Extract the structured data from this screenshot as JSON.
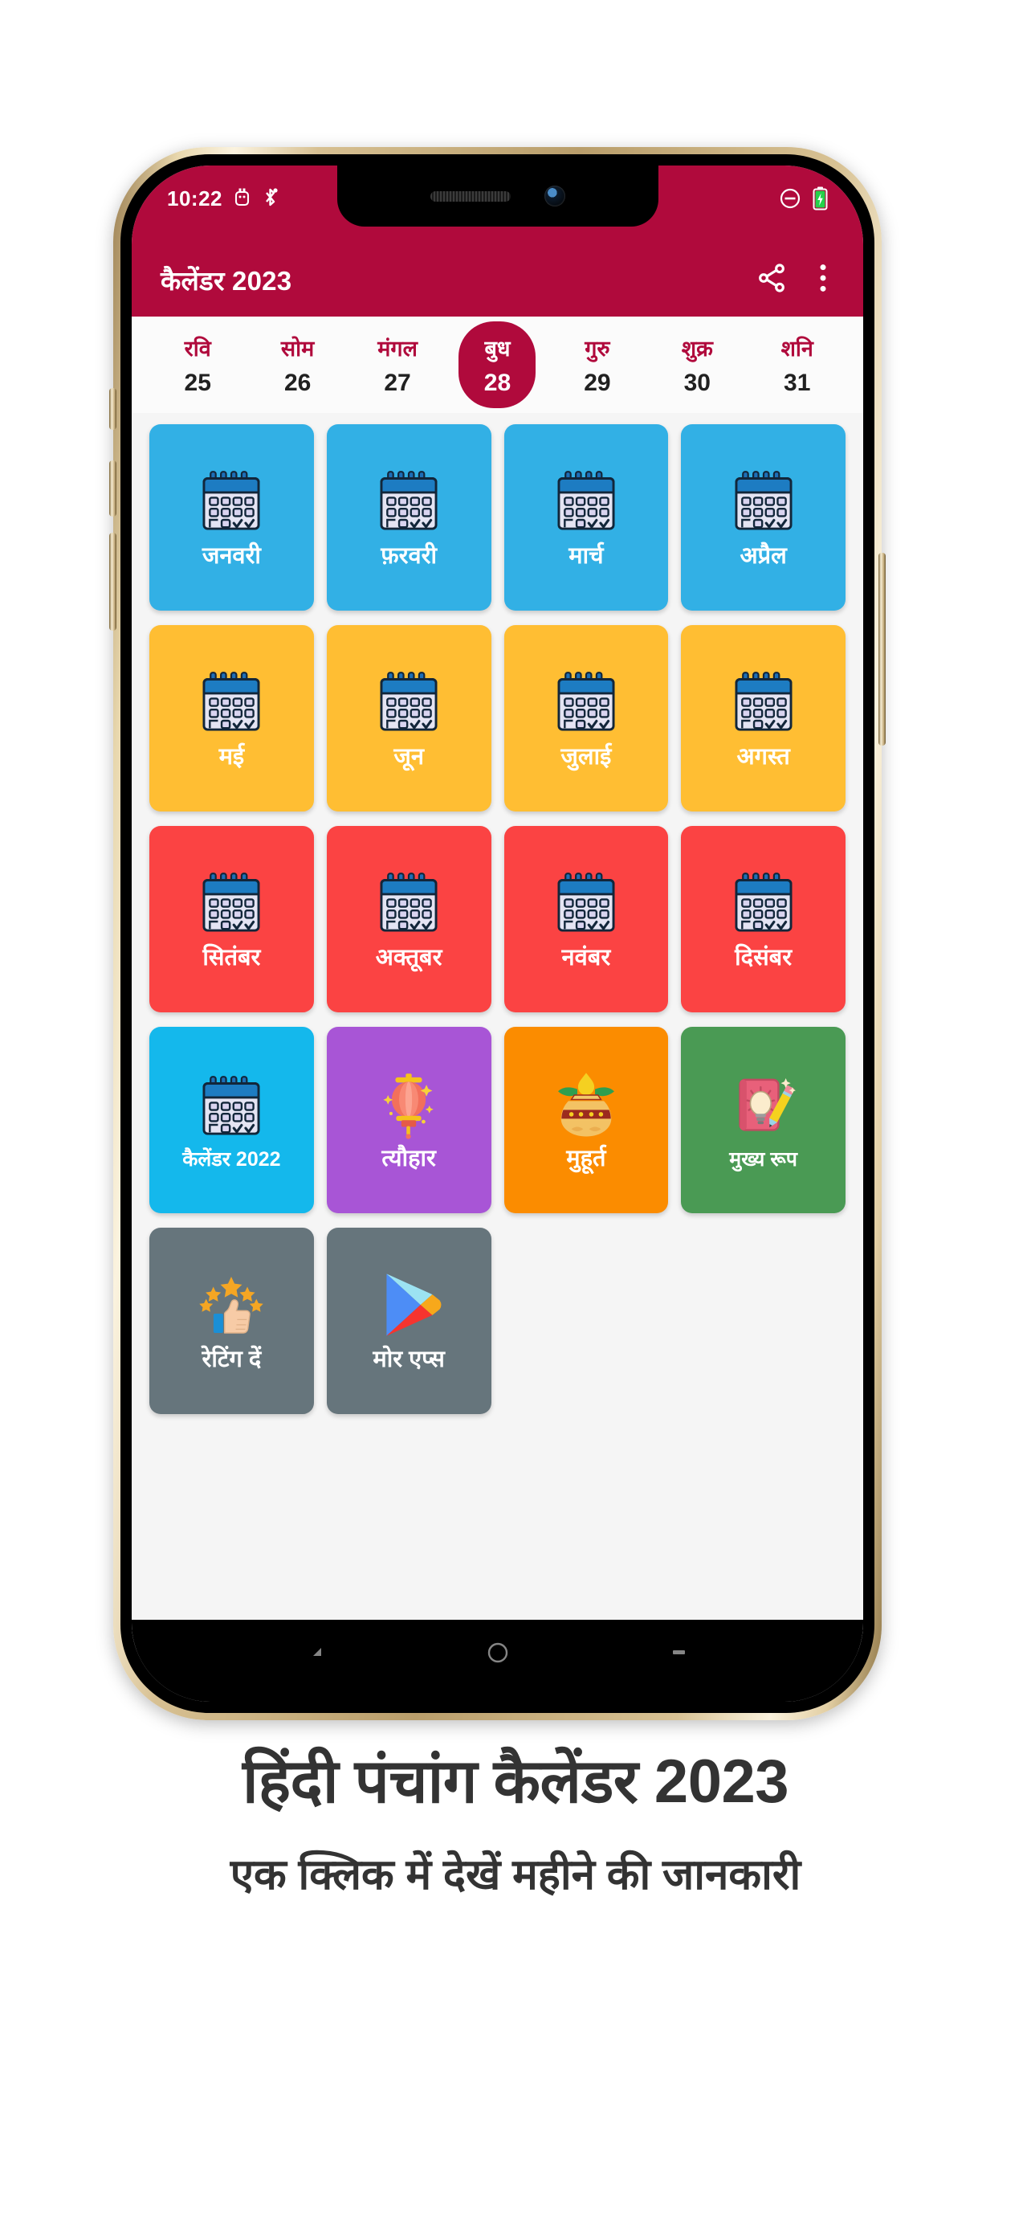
{
  "status_bar": {
    "time": "10:22",
    "left_icons": [
      "usb-debug-icon",
      "bluetooth-icon"
    ],
    "right_icons": [
      "do-not-disturb-icon",
      "battery-charging-icon"
    ],
    "background_color": "#b00a3c"
  },
  "app_bar": {
    "title": "कैलेंडर 2023",
    "share_icon": "share-icon",
    "overflow_icon": "more-vertical-icon",
    "background_color": "#b00a3c"
  },
  "week_strip": {
    "days": [
      {
        "name": "रवि",
        "num": "25",
        "selected": false
      },
      {
        "name": "सोम",
        "num": "26",
        "selected": false
      },
      {
        "name": "मंगल",
        "num": "27",
        "selected": false
      },
      {
        "name": "बुध",
        "num": "28",
        "selected": true
      },
      {
        "name": "गुरु",
        "num": "29",
        "selected": false
      },
      {
        "name": "शुक्र",
        "num": "30",
        "selected": false
      },
      {
        "name": "शनि",
        "num": "31",
        "selected": false
      }
    ],
    "selected_color": "#b00a3c",
    "label_color": "#b00a3c"
  },
  "tiles": [
    {
      "label": "जनवरी",
      "icon": "calendar-icon",
      "color": "#32b0e5"
    },
    {
      "label": "फ़रवरी",
      "icon": "calendar-icon",
      "color": "#32b0e5"
    },
    {
      "label": "मार्च",
      "icon": "calendar-icon",
      "color": "#32b0e5"
    },
    {
      "label": "अप्रैल",
      "icon": "calendar-icon",
      "color": "#32b0e5"
    },
    {
      "label": "मई",
      "icon": "calendar-icon",
      "color": "#ffbe33"
    },
    {
      "label": "जून",
      "icon": "calendar-icon",
      "color": "#ffbe33"
    },
    {
      "label": "जुलाई",
      "icon": "calendar-icon",
      "color": "#ffbe33"
    },
    {
      "label": "अगस्त",
      "icon": "calendar-icon",
      "color": "#ffbe33"
    },
    {
      "label": "सितंबर",
      "icon": "calendar-icon",
      "color": "#fb4343"
    },
    {
      "label": "अक्तूबर",
      "icon": "calendar-icon",
      "color": "#fb4343"
    },
    {
      "label": "नवंबर",
      "icon": "calendar-icon",
      "color": "#fb4343"
    },
    {
      "label": "दिसंबर",
      "icon": "calendar-icon",
      "color": "#fb4343"
    },
    {
      "label": "कैलेंडर 2022",
      "icon": "calendar-icon",
      "color": "#14b8ec",
      "small": true
    },
    {
      "label": "त्यौहार",
      "icon": "lantern-icon",
      "color": "#a855d6"
    },
    {
      "label": "मुहूर्त",
      "icon": "kalash-icon",
      "color": "#fb8c00"
    },
    {
      "label": "मुख्य रूप",
      "icon": "idea-book-icon",
      "color": "#4a9a54",
      "small": true
    },
    {
      "label": "रेटिंग दें",
      "icon": "thumbs-up-stars-icon",
      "color": "#66757c"
    },
    {
      "label": "मोर एप्स",
      "icon": "play-store-icon",
      "color": "#66757c"
    }
  ],
  "nav_bar": {
    "back_icon": "back-triangle-icon",
    "home_icon": "home-circle-icon",
    "recents_icon": "recents-rectangle-icon"
  },
  "caption": {
    "title": "हिंदी पंचांग कैलेंडर 2023",
    "subtitle": "एक क्लिक में देखें महीने की जानकारी",
    "color": "#333333"
  }
}
